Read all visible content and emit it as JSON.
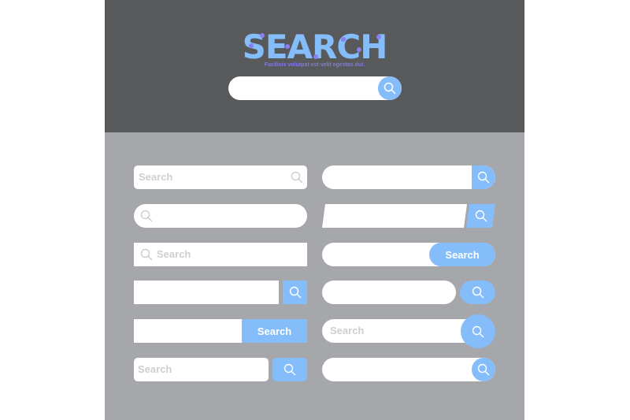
{
  "header": {
    "title": "SEARCH",
    "subtitle": "Facilisis volutpat est velit egestas dui."
  },
  "colors": {
    "accent": "#84bdfa",
    "header_bg": "#58595b",
    "panel_bg": "#a6a7ab",
    "placeholder": "#cfcfd1",
    "dots": "#8b7ff0"
  },
  "bars": {
    "b1": {
      "placeholder": "Search"
    },
    "b5": {
      "placeholder": "Search"
    },
    "b7": {
      "button_label": "Search"
    },
    "b9": {
      "button_label": "Search"
    },
    "b10": {
      "placeholder": "Search"
    },
    "b11": {
      "placeholder": "Search"
    }
  },
  "icons": {
    "search": "search-icon"
  }
}
